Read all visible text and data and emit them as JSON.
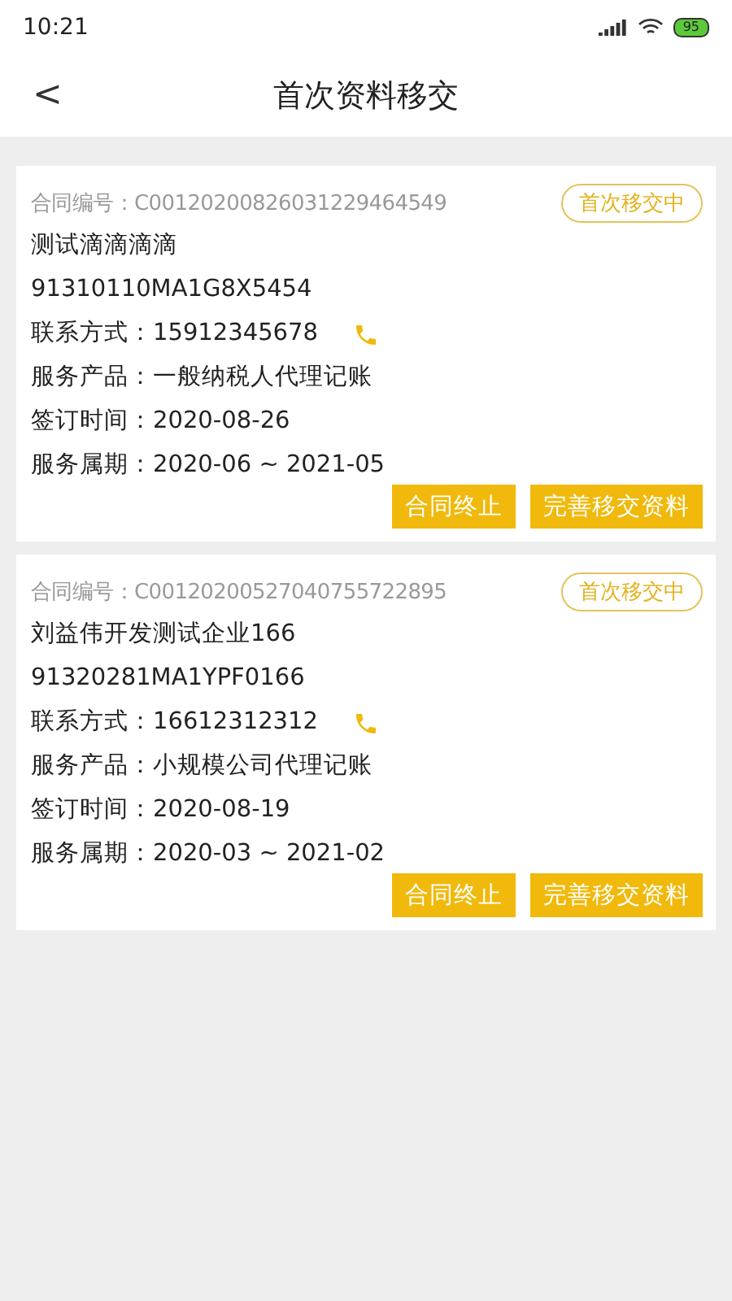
{
  "status_bar": {
    "time": "10:21",
    "battery": "95"
  },
  "header": {
    "back": "<",
    "title": "首次资料移交"
  },
  "contracts": [
    {
      "number": "合同编号：C00120200826031229464549",
      "status": "首次移交中",
      "company": "测试滴滴滴滴",
      "code": "91310110MA1G8X5454",
      "contact": "联系方式：15912345678",
      "product": "服务产品：一般纳税人代理记账",
      "signed": "签订时间：2020-08-26",
      "period": "服务属期：2020-06 ~ 2021-05",
      "buttons": [
        "合同终止",
        "完善移交资料"
      ]
    },
    {
      "number": "合同编号：C00120200527040755722895",
      "status": "首次移交中",
      "company": "刘益伟开发测试企业166",
      "code": "91320281MA1YPF0166",
      "contact": "联系方式：16612312312",
      "product": "服务产品：小规模公司代理记账",
      "signed": "签订时间：2020-08-19",
      "period": "服务属期：2020-03 ~ 2021-02",
      "buttons": [
        "合同终止",
        "完善移交资料"
      ]
    }
  ]
}
